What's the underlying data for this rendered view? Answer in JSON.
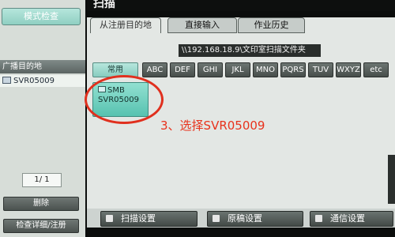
{
  "left_panel": {
    "mode_check": "模式检查",
    "broadcast_header": "广播目的地",
    "broadcast_items": [
      "SVR05009"
    ],
    "page_counter": "1/ 1",
    "delete_button": "删除",
    "detail_button": "检查详细/注册"
  },
  "header": {
    "title": "扫描"
  },
  "tabs": [
    {
      "label": "从注册目的地",
      "active": true
    },
    {
      "label": "直接输入",
      "active": false
    },
    {
      "label": "作业历史",
      "active": false
    }
  ],
  "path": "\\\\192.168.18.9\\文印室扫描文件夹",
  "filters": [
    {
      "label": "常用",
      "active": true
    },
    {
      "label": "ABC",
      "active": false
    },
    {
      "label": "DEF",
      "active": false
    },
    {
      "label": "GHI",
      "active": false
    },
    {
      "label": "JKL",
      "active": false
    },
    {
      "label": "MNO",
      "active": false
    },
    {
      "label": "PQRS",
      "active": false
    },
    {
      "label": "TUV",
      "active": false
    },
    {
      "label": "WXYZ",
      "active": false
    },
    {
      "label": "etc",
      "active": false
    }
  ],
  "destination": {
    "protocol": "SMB",
    "name": "SVR05009",
    "icon": "smb-folder-icon"
  },
  "annotation": {
    "text": "3、选择SVR05009",
    "color": "#e8321c"
  },
  "bottom_buttons": [
    {
      "label": "扫描设置",
      "icon": "scan-settings-icon"
    },
    {
      "label": "原稿设置",
      "icon": "original-settings-icon"
    },
    {
      "label": "通信设置",
      "icon": "communication-settings-icon"
    }
  ],
  "colors": {
    "accent": "#8fd6c8",
    "annotation": "#e8321c"
  }
}
